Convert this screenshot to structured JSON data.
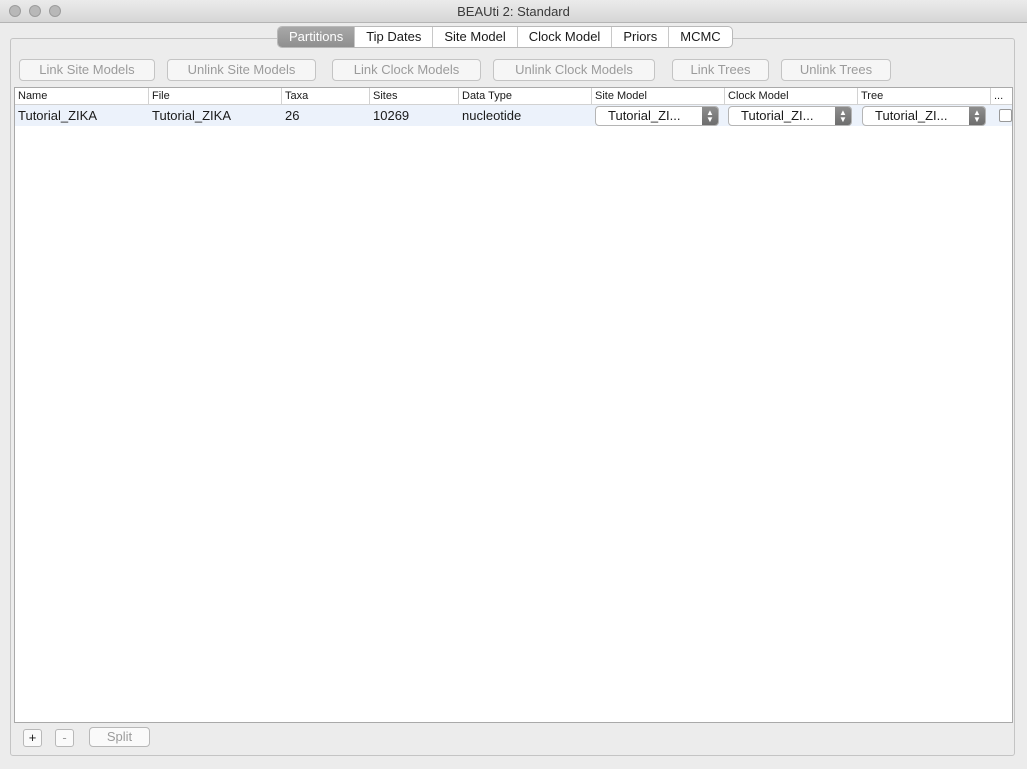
{
  "window": {
    "title": "BEAUti 2: Standard"
  },
  "tabs": [
    {
      "label": "Partitions"
    },
    {
      "label": "Tip Dates"
    },
    {
      "label": "Site Model"
    },
    {
      "label": "Clock Model"
    },
    {
      "label": "Priors"
    },
    {
      "label": "MCMC"
    }
  ],
  "toolbar": {
    "link_site_models": "Link Site Models",
    "unlink_site_models": "Unlink Site Models",
    "link_clock_models": "Link Clock Models",
    "unlink_clock_models": "Unlink Clock Models",
    "link_trees": "Link Trees",
    "unlink_trees": "Unlink Trees"
  },
  "table": {
    "columns": [
      "Name",
      "File",
      "Taxa",
      "Sites",
      "Data Type",
      "Site Model",
      "Clock Model",
      "Tree",
      "..."
    ],
    "rows": [
      {
        "name": "Tutorial_ZIKA",
        "file": "Tutorial_ZIKA",
        "taxa": "26",
        "sites": "10269",
        "data_type": "nucleotide",
        "site_model": "Tutorial_ZI...",
        "clock_model": "Tutorial_ZI...",
        "tree": "Tutorial_ZI..."
      }
    ]
  },
  "bottom": {
    "add": "+",
    "remove": "-",
    "split": "Split"
  }
}
